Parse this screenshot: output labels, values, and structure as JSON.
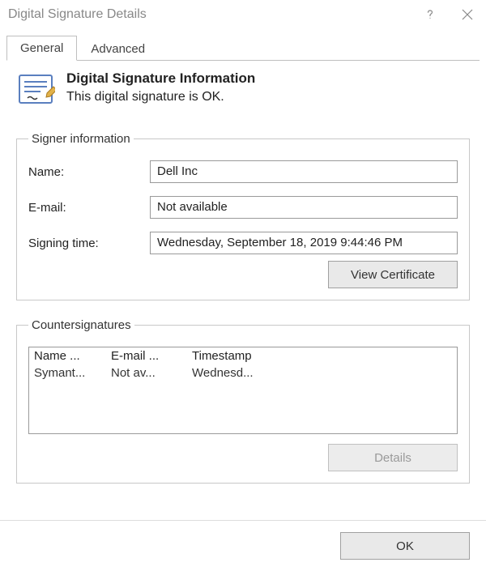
{
  "window": {
    "title": "Digital Signature Details"
  },
  "tabs": {
    "general": "General",
    "advanced": "Advanced"
  },
  "info": {
    "heading": "Digital Signature Information",
    "subtext": "This digital signature is OK."
  },
  "signer": {
    "legend": "Signer information",
    "name_label": "Name:",
    "name_value": "Dell Inc",
    "email_label": "E-mail:",
    "email_value": "Not available",
    "time_label": "Signing time:",
    "time_value": "Wednesday, September 18, 2019 9:44:46 PM",
    "view_cert_button": "View Certificate"
  },
  "countersigs": {
    "legend": "Countersignatures",
    "headers": {
      "name": "Name ...",
      "email": "E-mail ...",
      "timestamp": "Timestamp"
    },
    "rows": [
      {
        "name": "Symant...",
        "email": "Not av...",
        "timestamp": "Wednesd..."
      }
    ],
    "details_button": "Details"
  },
  "footer": {
    "ok_button": "OK"
  }
}
